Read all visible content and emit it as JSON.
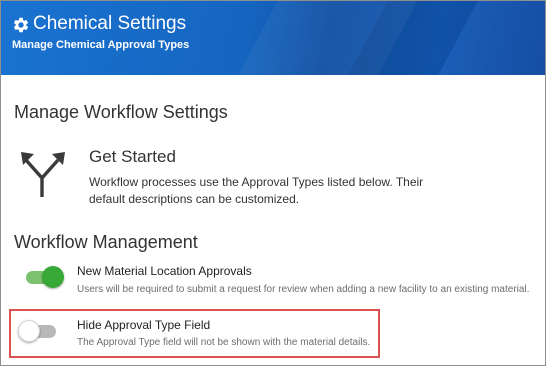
{
  "header": {
    "title": "Chemical Settings",
    "subtitle": "Manage Chemical Approval Types",
    "icon": "gear-icon"
  },
  "workflow_settings": {
    "heading": "Manage Workflow Settings",
    "get_started": {
      "icon": "branch-arrows-icon",
      "title": "Get Started",
      "description": "Workflow processes use the Approval Types listed below. Their default descriptions can be customized."
    }
  },
  "workflow_management": {
    "heading": "Workflow Management",
    "options": [
      {
        "label": "New Material Location Approvals",
        "description": "Users will be required to submit a request for review when adding a new facility to an existing material.",
        "enabled": true
      },
      {
        "label": "Hide Approval Type Field",
        "description": "The Approval Type field will not be shown with the material details.",
        "enabled": false,
        "highlighted": true
      }
    ]
  },
  "colors": {
    "header_blue": "#1565c0",
    "toggle_on": "#38a836",
    "toggle_off": "#b8b8b8",
    "highlight_border": "#d9534f"
  }
}
